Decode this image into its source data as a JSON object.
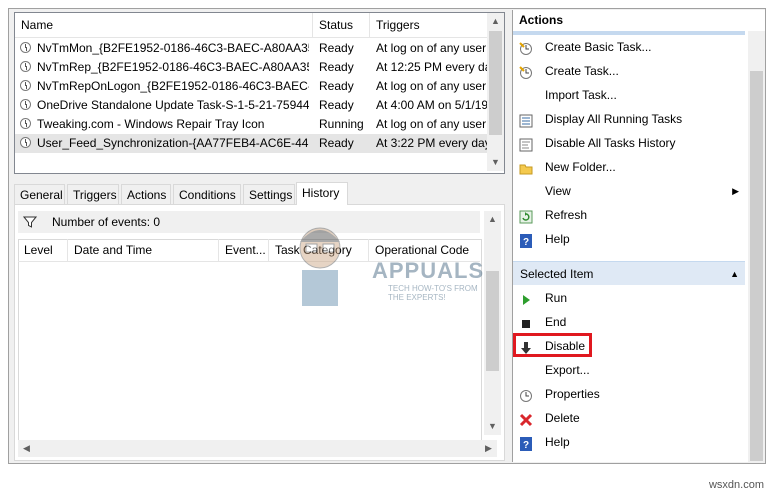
{
  "task_list": {
    "columns": [
      "Name",
      "Status",
      "Triggers"
    ],
    "rows": [
      {
        "name": "NvTmMon_{B2FE1952-0186-46C3-BAEC-A80AA35...",
        "status": "Ready",
        "trigger": "At log on of any user"
      },
      {
        "name": "NvTmRep_{B2FE1952-0186-46C3-BAEC-A80AA35...",
        "status": "Ready",
        "trigger": "At 12:25 PM every da"
      },
      {
        "name": "NvTmRepOnLogon_{B2FE1952-0186-46C3-BAEC-...",
        "status": "Ready",
        "trigger": "At log on of any user"
      },
      {
        "name": "OneDrive Standalone Update Task-S-1-5-21-75944...",
        "status": "Ready",
        "trigger": "At 4:00 AM on 5/1/19"
      },
      {
        "name": "Tweaking.com - Windows Repair Tray Icon",
        "status": "Running",
        "trigger": "At log on of any user"
      },
      {
        "name": "User_Feed_Synchronization-{AA77FEB4-AC6E-442...",
        "status": "Ready",
        "trigger": "At 3:22 PM every day"
      }
    ]
  },
  "tabs": [
    "General",
    "Triggers",
    "Actions",
    "Conditions",
    "Settings",
    "History"
  ],
  "active_tab": "History",
  "history": {
    "events_label": "Number of events: 0",
    "columns": [
      "Level",
      "Date and Time",
      "Event...",
      "Task Category",
      "Operational Code"
    ]
  },
  "actions_pane": {
    "title": "Actions",
    "top_items": [
      {
        "label": "Create Basic Task...",
        "icon": "create-basic-task-icon"
      },
      {
        "label": "Create Task...",
        "icon": "create-task-icon"
      },
      {
        "label": "Import Task...",
        "icon": ""
      },
      {
        "label": "Display All Running Tasks",
        "icon": "running-tasks-icon"
      },
      {
        "label": "Disable All Tasks History",
        "icon": "tasks-history-icon"
      },
      {
        "label": "New Folder...",
        "icon": "folder-icon"
      },
      {
        "label": "View",
        "icon": ""
      },
      {
        "label": "Refresh",
        "icon": "refresh-icon"
      },
      {
        "label": "Help",
        "icon": "help-icon"
      }
    ],
    "section_title": "Selected Item",
    "selected_items": [
      {
        "label": "Run",
        "icon": "run-icon"
      },
      {
        "label": "End",
        "icon": "end-icon"
      },
      {
        "label": "Disable",
        "icon": "disable-icon"
      },
      {
        "label": "Export...",
        "icon": ""
      },
      {
        "label": "Properties",
        "icon": "properties-icon"
      },
      {
        "label": "Delete",
        "icon": "delete-icon"
      },
      {
        "label": "Help",
        "icon": "help-icon"
      }
    ]
  },
  "watermark": {
    "brand": "APPUALS",
    "tagline": "TECH HOW-TO'S FROM THE EXPERTS!",
    "site": "wsxdn.com"
  },
  "colors": {
    "highlight_border": "#e0181f",
    "section_bg": "#dfe9f5",
    "selected_row": "#e5e5e5"
  }
}
